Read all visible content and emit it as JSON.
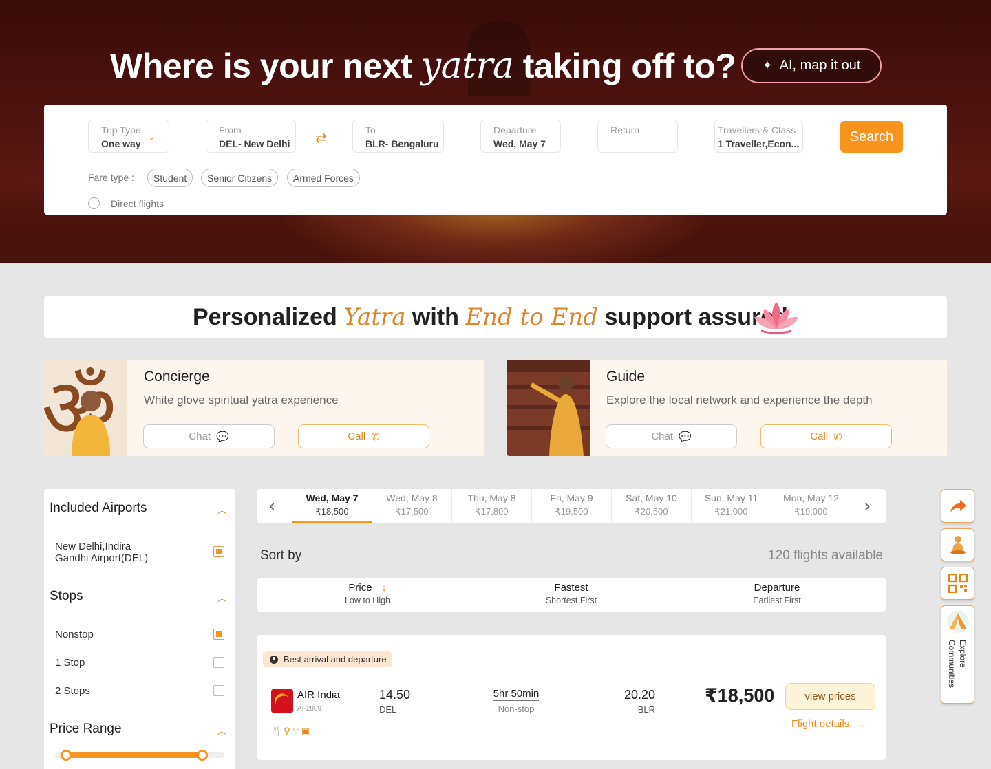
{
  "hero": {
    "title_before": "Where is your next ",
    "title_italic": "yatra",
    "title_after": " taking off to?",
    "ai_button": "AI, map it out"
  },
  "search": {
    "trip_type": {
      "label": "Trip Type",
      "value": "One way"
    },
    "from": {
      "label": "From",
      "value": "DEL- New Delhi"
    },
    "to": {
      "label": "To",
      "value": "BLR- Bengaluru"
    },
    "departure": {
      "label": "Departure",
      "value": "Wed, May 7"
    },
    "return": {
      "label": "Return",
      "value": ""
    },
    "travellers": {
      "label": "Travellers & Class",
      "value": "1 Traveller,Econ..."
    },
    "search_button": "Search",
    "fare_type_label": "Fare type :",
    "fare_types": [
      "Student",
      "Senior Citizens",
      "Armed Forces"
    ],
    "direct_flights_label": "Direct flights"
  },
  "banner": {
    "part1": "Personalized ",
    "part2": "Yatra",
    "part3": " with ",
    "part4": "End to End",
    "part5": " support assured"
  },
  "services": [
    {
      "title": "Concierge",
      "desc": "White glove spiritual yatra experience",
      "chat": "Chat",
      "call": "Call"
    },
    {
      "title": "Guide",
      "desc": "Explore the local network and experience the depth",
      "chat": "Chat",
      "call": "Call"
    }
  ],
  "filters": {
    "airports_title": "Included Airports",
    "airports": [
      "New Delhi,Indira",
      "Gandhi Airport(DEL)"
    ],
    "stops_title": "Stops",
    "stops": [
      "Nonstop",
      "1 Stop",
      "2 Stops"
    ],
    "price_range_title": "Price Range",
    "price_range": {
      "low": 0.1,
      "high": 0.87
    }
  },
  "dates": [
    {
      "day": "Wed, May 7",
      "price": "₹18,500",
      "active": true
    },
    {
      "day": "Wed, May 8",
      "price": "₹17,500"
    },
    {
      "day": "Thu, May 8",
      "price": "₹17,800"
    },
    {
      "day": "Fri, May 9",
      "price": "₹19,500"
    },
    {
      "day": "Sat, May 10",
      "price": "₹20,500"
    },
    {
      "day": "Sun, May 11",
      "price": "₹21,000"
    },
    {
      "day": "Mon, May 12",
      "price": "₹19,000"
    }
  ],
  "sort": {
    "label": "Sort by",
    "count": "120 flights available",
    "options": [
      {
        "title": "Price",
        "sub": "Low to High"
      },
      {
        "title": "Fastest",
        "sub": "Shortest First"
      },
      {
        "title": "Departure",
        "sub": "Earliest First"
      }
    ]
  },
  "flight": {
    "badge": "Best arrival and departure",
    "airline": "AIR India",
    "flight_no": "AI-2809",
    "dep_time": "14.50",
    "dep_code": "DEL",
    "duration": "5hr 50min",
    "stops": "Non-stop",
    "arr_time": "20.20",
    "arr_code": "BLR",
    "price": "₹18,500",
    "view_prices": "view prices",
    "details": "Flight details"
  },
  "rail": {
    "explore": "Explore Communities"
  },
  "colors": {
    "accent": "#f7941d",
    "hero_dark": "#4d1210",
    "card_cream": "#fdf6ee"
  }
}
